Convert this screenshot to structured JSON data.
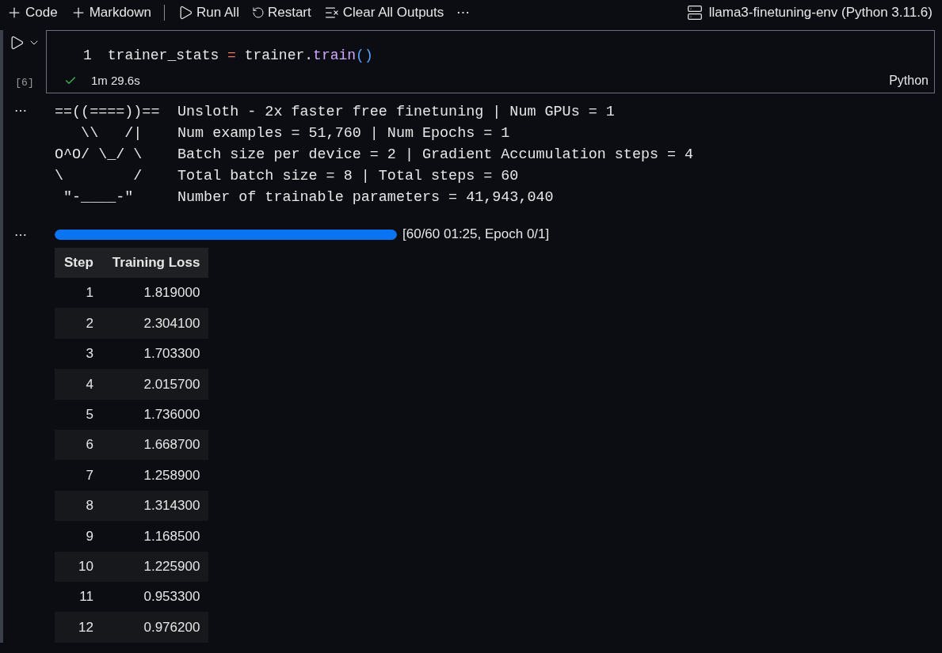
{
  "toolbar": {
    "buttons": [
      {
        "kind": "plus",
        "label": "Code"
      },
      {
        "kind": "plus",
        "label": "Markdown"
      },
      {
        "kind": "run",
        "label": "Run All"
      },
      {
        "kind": "restart",
        "label": "Restart"
      },
      {
        "kind": "clear",
        "label": "Clear All Outputs"
      },
      {
        "kind": "more",
        "label": "⋯"
      }
    ],
    "kernel": "llama3-finetuning-env (Python 3.11.6)"
  },
  "cell": {
    "execution_count": "[6]",
    "line_number": "1",
    "code": [
      {
        "kind": "var",
        "text": "trainer_stats"
      },
      {
        "kind": "op",
        "text": " = "
      },
      {
        "kind": "var",
        "text": "trainer."
      },
      {
        "kind": "fn",
        "text": "train"
      },
      {
        "kind": "paren",
        "text": "()"
      }
    ],
    "status": "1m 29.6s",
    "succeeded": true,
    "language": "Python"
  },
  "outputs": [
    {
      "kind": "text",
      "menu": "⋯",
      "lines": [
        {
          "art": "==((====))==",
          "text": "Unsloth - 2x faster free finetuning | Num GPUs = 1"
        },
        {
          "art": "   \\\\   /|",
          "text": "Num examples = 51,760 | Num Epochs = 1"
        },
        {
          "art": "O^O/ \\_/ \\",
          "text": "Batch size per device = 2 | Gradient Accumulation steps = 4"
        },
        {
          "art": "\\        /",
          "text": "Total batch size = 8 | Total steps = 60"
        },
        {
          "art": " \"-____-\"",
          "text": "Number of trainable parameters = 41,943,040"
        }
      ]
    },
    {
      "kind": "progress",
      "menu": "⋯",
      "level": 1,
      "label": "[60/60 01:25, Epoch 0/1]",
      "table": {
        "columns": [
          "Step",
          "Training Loss"
        ],
        "rows": [
          [
            "1",
            "1.819000"
          ],
          [
            "2",
            "2.304100"
          ],
          [
            "3",
            "1.703300"
          ],
          [
            "4",
            "2.015700"
          ],
          [
            "5",
            "1.736000"
          ],
          [
            "6",
            "1.668700"
          ],
          [
            "7",
            "1.258900"
          ],
          [
            "8",
            "1.314300"
          ],
          [
            "9",
            "1.168500"
          ],
          [
            "10",
            "1.225900"
          ],
          [
            "11",
            "0.953300"
          ],
          [
            "12",
            "0.976200"
          ]
        ]
      }
    }
  ]
}
